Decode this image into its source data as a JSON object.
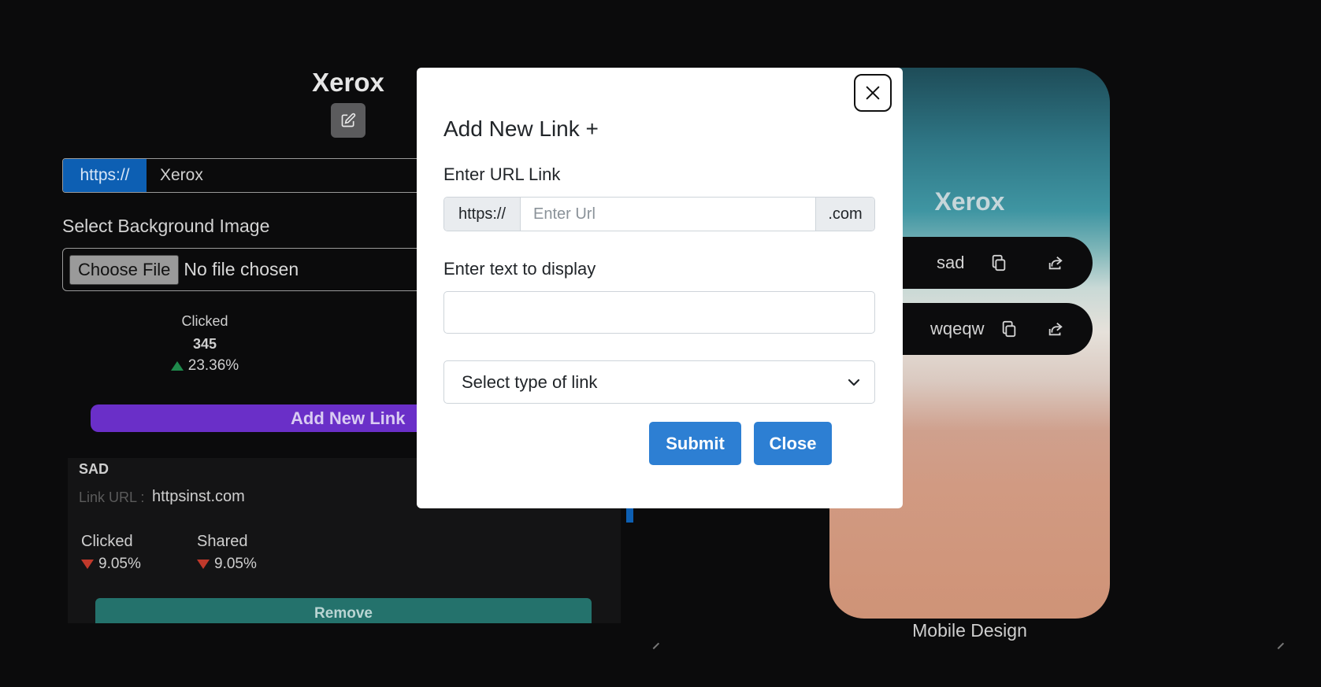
{
  "profile": {
    "title": "Xerox",
    "edit_icon": "edit-icon",
    "url_prefix": "https://",
    "url_value": "Xerox"
  },
  "background": {
    "label": "Select Background Image",
    "choose_file": "Choose File",
    "file_status": "No file chosen"
  },
  "overview_stat": {
    "label": "Clicked",
    "value": "345",
    "change": "23.36%",
    "trend": "up"
  },
  "add_link_label": "Add New Link",
  "link_card": {
    "title": "SAD",
    "url_label": "Link URL :",
    "url_value": "httpsinst.com",
    "clicked_label": "Clicked",
    "clicked_change": "9.05%",
    "shared_label": "Shared",
    "shared_change": "9.05%",
    "remove_label": "Remove"
  },
  "phone_preview": {
    "title": "Xerox",
    "links": [
      {
        "text": "sad"
      },
      {
        "text": "wqeqw"
      }
    ],
    "label": "Mobile Design"
  },
  "modal": {
    "title": "Add New Link +",
    "url_label": "Enter URL Link",
    "url_prefix": "https://",
    "url_placeholder": "Enter Url",
    "url_suffix": ".com",
    "display_label": "Enter text to display",
    "select_placeholder": "Select type of link",
    "submit_label": "Submit",
    "close_label": "Close"
  },
  "colors": {
    "accent_blue": "#2d7fd3",
    "purple": "#6a2fc8",
    "teal": "#24726c",
    "up": "#1f8a4c",
    "down": "#c0392b"
  }
}
